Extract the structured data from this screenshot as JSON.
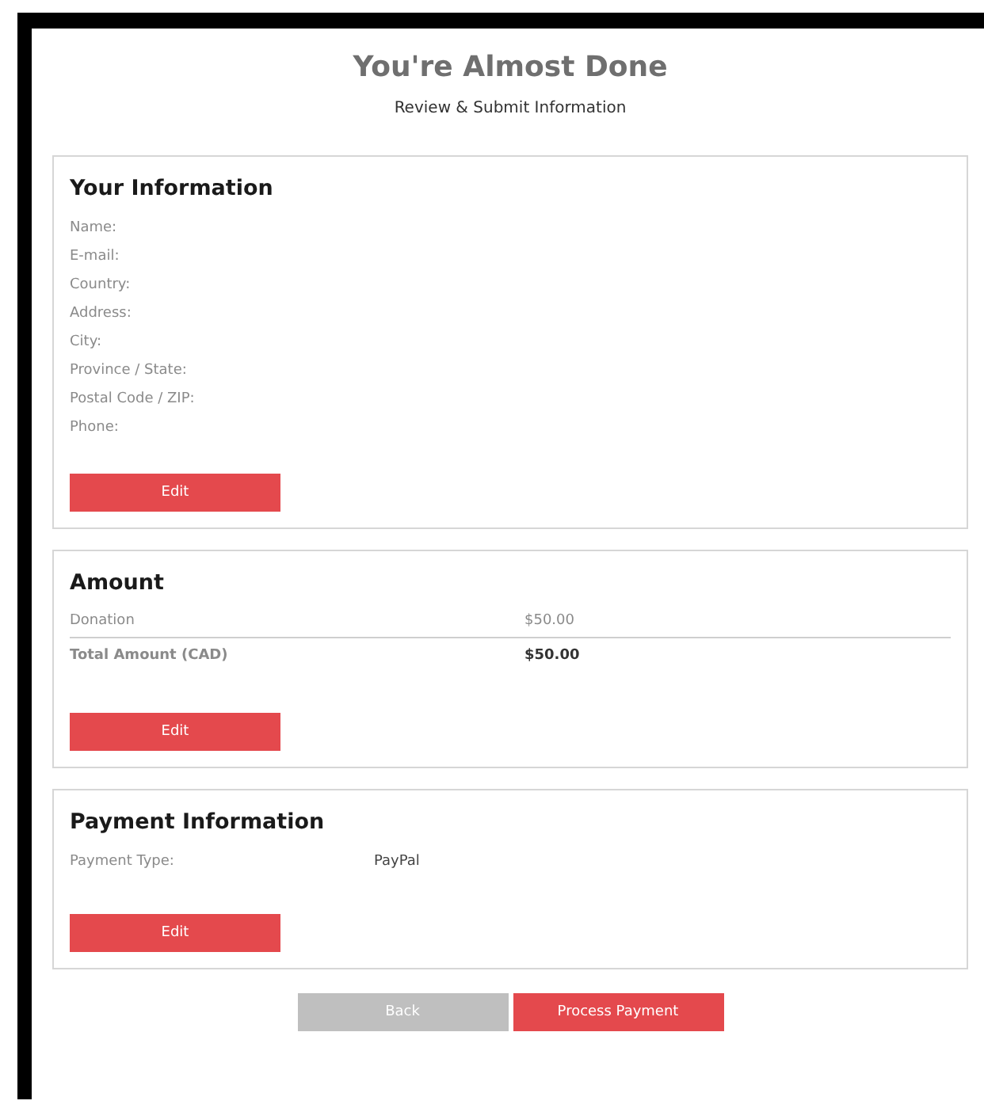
{
  "header": {
    "title": "You're Almost Done",
    "subtitle": "Review & Submit Information"
  },
  "sections": [
    {
      "kind": "details",
      "title": "Your Information",
      "fields": [
        {
          "label": "Name:"
        },
        {
          "label": "E-mail:"
        },
        {
          "label": "Country:"
        },
        {
          "label": "Address:"
        },
        {
          "label": "City:"
        },
        {
          "label": "Province / State:"
        },
        {
          "label": "Postal Code / ZIP:"
        },
        {
          "label": "Phone:"
        }
      ],
      "button": "Edit"
    },
    {
      "kind": "amount",
      "title": "Amount",
      "rows": [
        {
          "kind": "item",
          "label": "Donation",
          "value": "$50.00"
        },
        {
          "kind": "total",
          "label": "Total Amount (CAD)",
          "value": "$50.00"
        }
      ],
      "button": "Edit"
    },
    {
      "kind": "payment",
      "title": "Payment Information",
      "fields": [
        {
          "label": "Payment Type:",
          "value": "PayPal"
        }
      ],
      "button": "Edit"
    }
  ],
  "actions": [
    {
      "kind": "secondary",
      "label": "Back"
    },
    {
      "kind": "primary",
      "label": "Process Payment"
    }
  ]
}
